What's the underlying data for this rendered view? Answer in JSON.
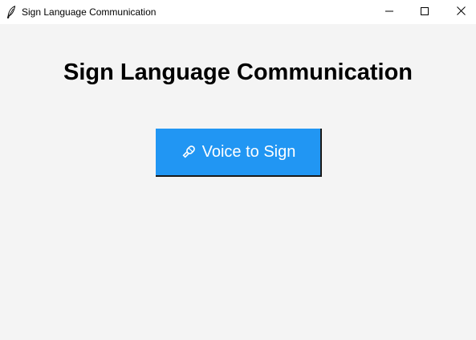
{
  "window": {
    "title": "Sign Language Communication",
    "icon": "feather-icon",
    "controls": [
      "minimize-icon",
      "maximize-icon",
      "close-icon"
    ]
  },
  "main": {
    "heading": "Sign Language Communication",
    "voice_button": {
      "label": "Voice to Sign",
      "icon": "microphone-icon",
      "color": "#2196f3"
    }
  },
  "colors": {
    "background": "#f4f4f4",
    "titlebar": "#ffffff",
    "button": "#2196f3",
    "button_text": "#ffffff"
  }
}
